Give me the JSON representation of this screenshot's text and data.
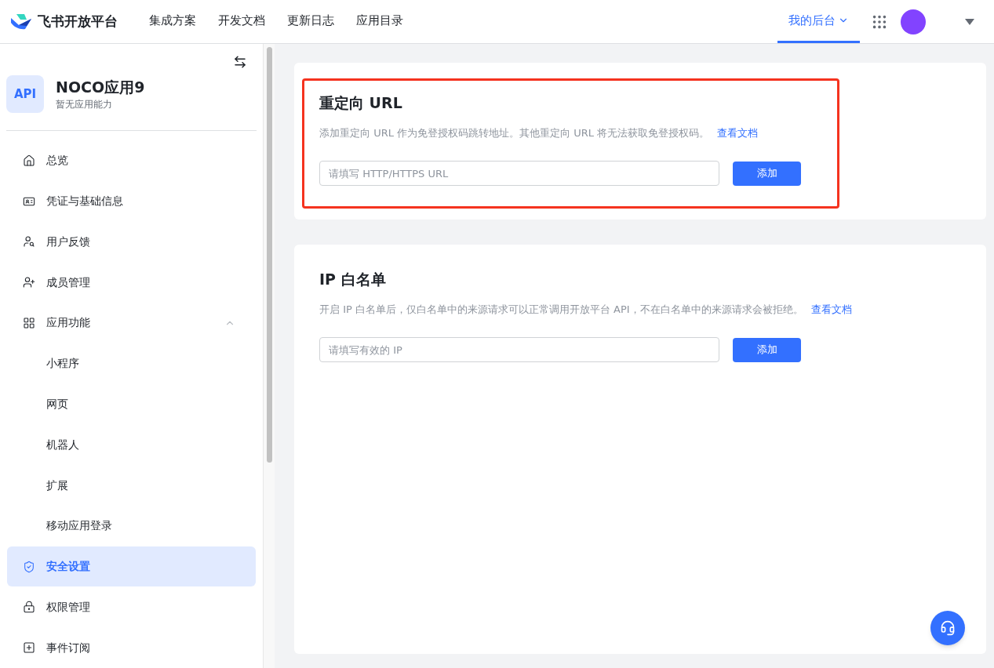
{
  "header": {
    "brand": "飞书开放平台",
    "nav": [
      {
        "label": "集成方案",
        "selected": false
      },
      {
        "label": "开发文档",
        "selected": false
      },
      {
        "label": "更新日志",
        "selected": false
      },
      {
        "label": "应用目录",
        "selected": false
      },
      {
        "label": "我的后台",
        "selected": true
      }
    ]
  },
  "sidebar": {
    "app": {
      "logo": "API",
      "name": "NOCO应用9",
      "subtitle": "暂无应用能力"
    },
    "items": [
      {
        "label": "总览",
        "selected": false
      },
      {
        "label": "凭证与基础信息",
        "selected": false
      },
      {
        "label": "用户反馈",
        "selected": false
      },
      {
        "label": "成员管理",
        "selected": false
      },
      {
        "label": "应用功能",
        "selected": false,
        "expanded": true,
        "children": [
          {
            "label": "小程序",
            "selected": false
          },
          {
            "label": "网页",
            "selected": false
          },
          {
            "label": "机器人",
            "selected": false
          },
          {
            "label": "扩展",
            "selected": false
          },
          {
            "label": "移动应用登录",
            "selected": false
          }
        ]
      },
      {
        "label": "安全设置",
        "selected": true
      },
      {
        "label": "权限管理",
        "selected": false
      },
      {
        "label": "事件订阅",
        "selected": false
      }
    ]
  },
  "sections": [
    {
      "title": "重定向 URL",
      "highlighted": true,
      "description": "添加重定向 URL 作为免登授权码跳转地址。其他重定向 URL 将无法获取免登授权码。",
      "link": "查看文档",
      "input": {
        "placeholder": "请填写 HTTP/HTTPS URL"
      },
      "button": "添加"
    },
    {
      "title": "IP 白名单",
      "highlighted": false,
      "description": "开启 IP 白名单后，仅白名单中的来源请求可以正常调用开放平台 API，不在白名单中的来源请求会被拒绝。",
      "link": "查看文档",
      "input": {
        "placeholder": "请填写有效的 IP"
      },
      "button": "添加"
    }
  ]
}
